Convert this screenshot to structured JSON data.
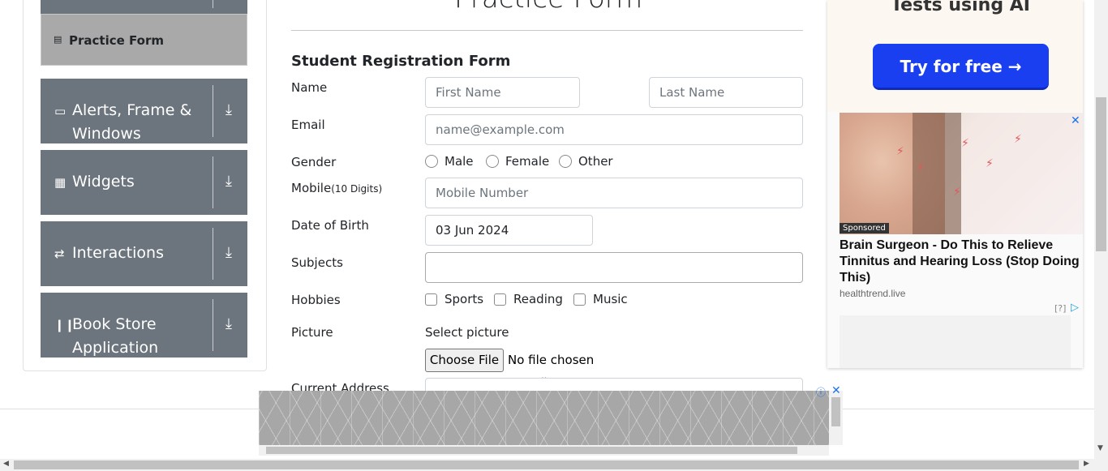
{
  "sidebar": {
    "active_item": {
      "label": "Practice Form",
      "icon": "form-icon"
    },
    "groups": [
      {
        "label": "Alerts, Frame & Windows",
        "icon": "window-icon"
      },
      {
        "label": "Widgets",
        "icon": "widgets-icon"
      },
      {
        "label": "Interactions",
        "icon": "interactions-icon"
      },
      {
        "label": "Book Store Application",
        "icon": "books-icon"
      }
    ]
  },
  "form": {
    "title": "Practice Form",
    "heading": "Student Registration Form",
    "name_label": "Name",
    "first_name_placeholder": "First Name",
    "last_name_placeholder": "Last Name",
    "email_label": "Email",
    "email_placeholder": "name@example.com",
    "gender_label": "Gender",
    "gender_options": [
      "Male",
      "Female",
      "Other"
    ],
    "mobile_label": "Mobile",
    "mobile_hint": "(10 Digits)",
    "mobile_placeholder": "Mobile Number",
    "dob_label": "Date of Birth",
    "dob_value": "03 Jun 2024",
    "subjects_label": "Subjects",
    "hobbies_label": "Hobbies",
    "hobby_options": [
      "Sports",
      "Reading",
      "Music"
    ],
    "picture_label": "Picture",
    "select_picture_label": "Select picture",
    "choose_file_button": "Choose File",
    "no_file_text": "No file chosen",
    "current_address_label": "Current Address"
  },
  "right_ad": {
    "tagline": "Tests using AI",
    "cta": "Try for free →",
    "sponsored": "Sponsored",
    "headline": "Brain Surgeon - Do This to Relieve Tinnitus and Hearing Loss (Stop Doing This)",
    "domain": "healthtrend.live",
    "help": "[?]"
  }
}
